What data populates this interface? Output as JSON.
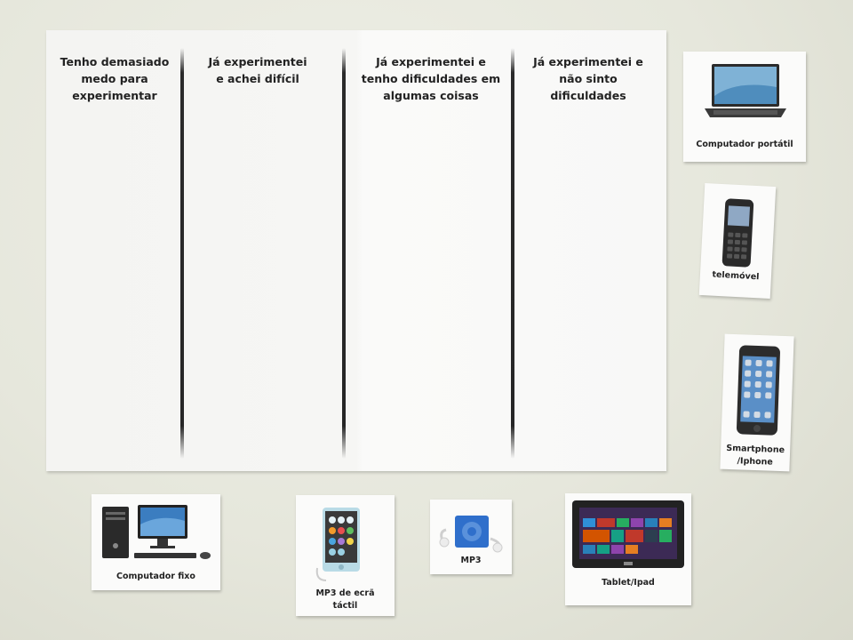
{
  "poster": {
    "columns": [
      {
        "title": "Tenho demasiado\nmedo para\nexperimentar"
      },
      {
        "title": "Já experimentei\ne achei difícil"
      },
      {
        "title": "Já experimentei e\ntenho dificuldades em\nalgumas coisas"
      },
      {
        "title": "Já experimentei e\nnão sinto\ndificuldades"
      }
    ]
  },
  "cards": {
    "laptop": {
      "label": "Computador portátil",
      "icon": "laptop-icon"
    },
    "mobile_phone": {
      "label": "telemóvel",
      "icon": "mobile-phone-icon"
    },
    "smartphone": {
      "label": "Smartphone\n/Iphone",
      "icon": "smartphone-icon"
    },
    "desktop": {
      "label": "Computador fixo",
      "icon": "desktop-computer-icon"
    },
    "mp3_touch": {
      "label": "MP3 de ecrã\ntáctil",
      "icon": "mp3-touch-icon"
    },
    "mp3": {
      "label": "MP3",
      "icon": "mp3-player-icon"
    },
    "tablet": {
      "label": "Tablet/Ipad",
      "icon": "tablet-icon"
    }
  },
  "colors": {
    "wall": "#e6e7dc",
    "paper": "#f6f6f4",
    "divider": "#262626",
    "mp3_blue": "#2f6fcb"
  }
}
